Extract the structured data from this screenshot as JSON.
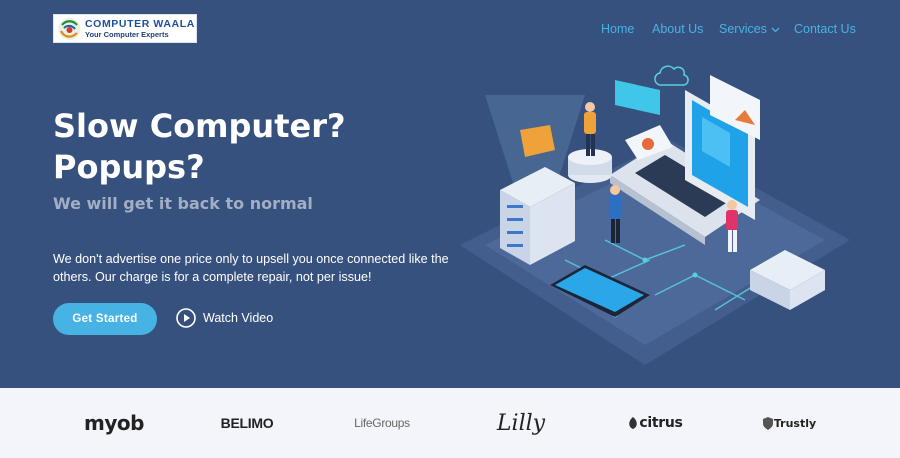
{
  "header": {
    "logo": {
      "name": "COMPUTER WAALA",
      "tagline": "Your Computer Experts"
    },
    "nav": [
      "Home",
      "About Us",
      "Services",
      "Contact Us"
    ]
  },
  "hero": {
    "title_line1": "Slow Computer?",
    "title_line2": "Popups?",
    "subtitle": "We will get it back to normal",
    "description": "We don't advertise one price only to upsell you once connected like the others. Our charge is for a complete repair, not per issue!",
    "cta_label": "Get Started",
    "video_label": "Watch Video"
  },
  "clients": [
    "myob",
    "BELIMO",
    "LifeGroups",
    "Lilly",
    "citrus",
    "Trustly"
  ],
  "colors": {
    "hero_bg": "#37517e",
    "accent": "#47b2e4",
    "subtitle": "#a3aec4",
    "clients_bg": "#f3f5fa"
  },
  "icons": [
    "chevron-down-icon",
    "play-icon",
    "logo-emblem-icon"
  ]
}
